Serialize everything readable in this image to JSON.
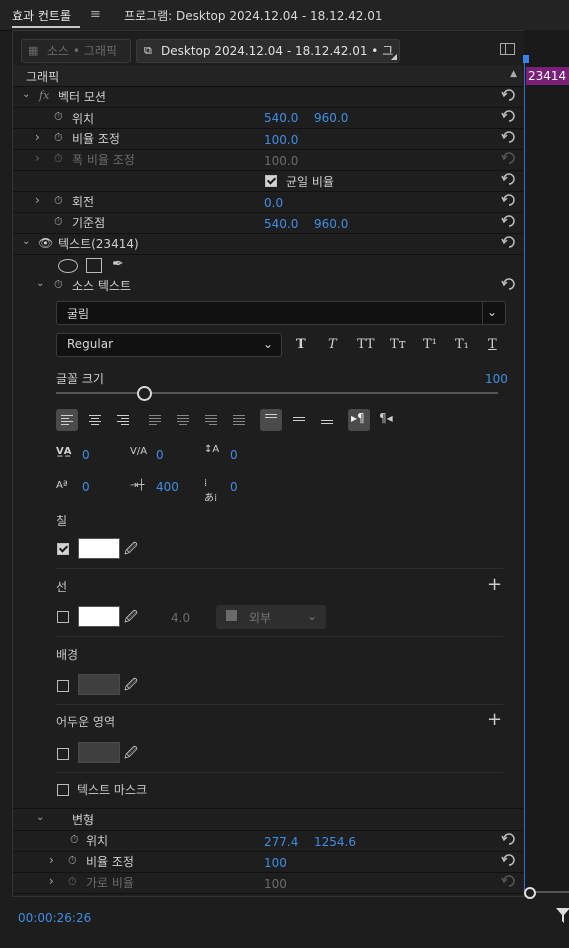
{
  "header": {
    "panel_tab": "효과 컨트롤",
    "program_title": "프로그램: Desktop 2024.12.04 - 18.12.42.01"
  },
  "source_tabs": {
    "inactive": "소스 • 그래픽",
    "active": "Desktop 2024.12.04 - 18.12.42.01 • 그래픽"
  },
  "clip_label": "23414",
  "section_graphic": "그래픽",
  "vector_motion": {
    "label": "벡터 모션",
    "position": {
      "label": "위치",
      "x": "540.0",
      "y": "960.0"
    },
    "scale": {
      "label": "비율 조정",
      "value": "100.0"
    },
    "scale_width": {
      "label": "폭 비율 조정",
      "value": "100.0"
    },
    "uniform_scale": {
      "label": "균일 비율",
      "checked": true
    },
    "rotation": {
      "label": "회전",
      "value": "0.0"
    },
    "anchor": {
      "label": "기준점",
      "x": "540.0",
      "y": "960.0"
    }
  },
  "text_layer": {
    "label": "텍스트(23414)"
  },
  "source_text": {
    "label": "소스 텍스트",
    "font": "굴림",
    "style": "Regular",
    "font_size_label": "글꼴 크기",
    "font_size_value": "100",
    "font_size_fraction": 0.2,
    "kerning": "0",
    "tracking": "0",
    "leading": "0",
    "baseline": "0",
    "tab_width": "400",
    "tsume": "0"
  },
  "fill": {
    "label": "칠",
    "checked": true,
    "color": "#ffffff"
  },
  "stroke": {
    "label": "선",
    "checked": false,
    "color": "#ffffff",
    "width": "4.0",
    "position": "외부"
  },
  "background": {
    "label": "배경",
    "checked": false,
    "color": "#404040"
  },
  "shadow": {
    "label": "어두운 영역",
    "checked": false,
    "color": "#404040"
  },
  "text_mask": {
    "label": "텍스트 마스크",
    "checked": false
  },
  "transform": {
    "label": "변형",
    "position": {
      "label": "위치",
      "x": "277.4",
      "y": "1254.6"
    },
    "scale": {
      "label": "비율 조정",
      "value": "100"
    },
    "aspect": {
      "label": "가로 비율",
      "value": "100"
    }
  },
  "footer": {
    "timecode": "00:00:26:26"
  },
  "icons": {
    "menu": "hamburger-icon",
    "stopwatch": "stopwatch-icon",
    "reset": "reset-icon",
    "eye": "eye-icon",
    "fx": "fx-icon",
    "eyedropper": "eyedropper-icon",
    "plus": "plus-icon",
    "chevron": "chevron-icon",
    "filter": "filter-icon"
  },
  "colors": {
    "accent": "#3f8ee6",
    "clip": "#7a1f7a",
    "playhead": "#2f6fd8"
  }
}
